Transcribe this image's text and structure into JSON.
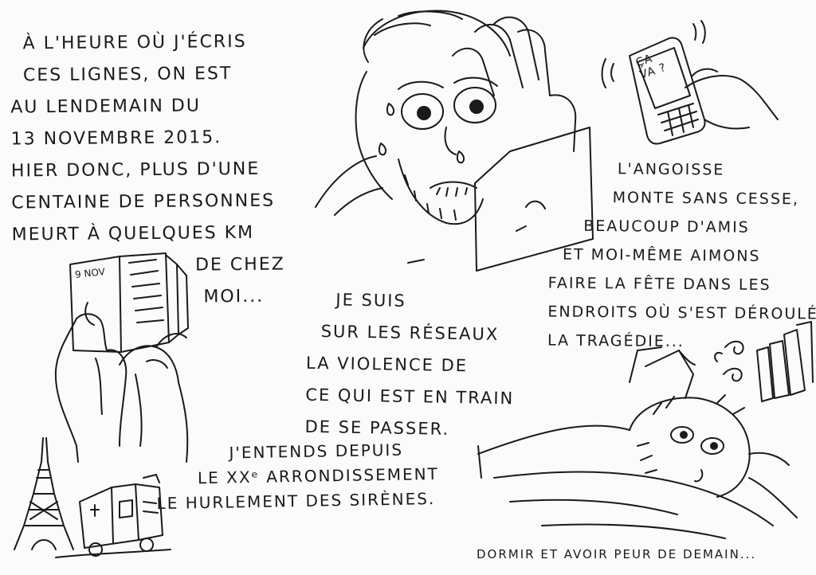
{
  "intro_text": [
    "À L'HEURE OÙ J'ÉCRIS",
    "CES LIGNES, ON EST",
    "AU LENDEMAIN DU",
    "13 NOVEMBRE 2015.",
    "HIER DONC, PLUS D'UNE",
    "CENTAINE DE PERSONNES",
    "MEURT À QUELQUES KM",
    "DE CHEZ",
    "MOI..."
  ],
  "newspaper_text": "9 NOV",
  "phone_text": [
    "ÇA",
    "VA ?"
  ],
  "anxiety_text": [
    "L'ANGOISSE",
    "MONTE SANS CESSE,",
    "BEAUCOUP D'AMIS",
    "ET MOI-MÊME AIMONS",
    "FAIRE LA FÊTE DANS LES",
    "ENDROITS OÙ S'EST DÉROULÉ",
    "LA TRAGÉDIE..."
  ],
  "network_text": [
    "JE SUIS",
    "SUR LES RÉSEAUX",
    "LA VIOLENCE DE",
    "CE QUI EST EN TRAIN",
    "DE SE PASSER."
  ],
  "sirens_text": [
    "J'ENTENDS DEPUIS",
    "LE XXᵉ ARRONDISSEMENT",
    "LE HURLEMENT DES SIRÈNES."
  ],
  "sleep_caption": "DORMIR ET AVOIR PEUR DE DEMAIN...",
  "ink_color": "#1a1a1a",
  "paper_color": "#fbfbfb"
}
